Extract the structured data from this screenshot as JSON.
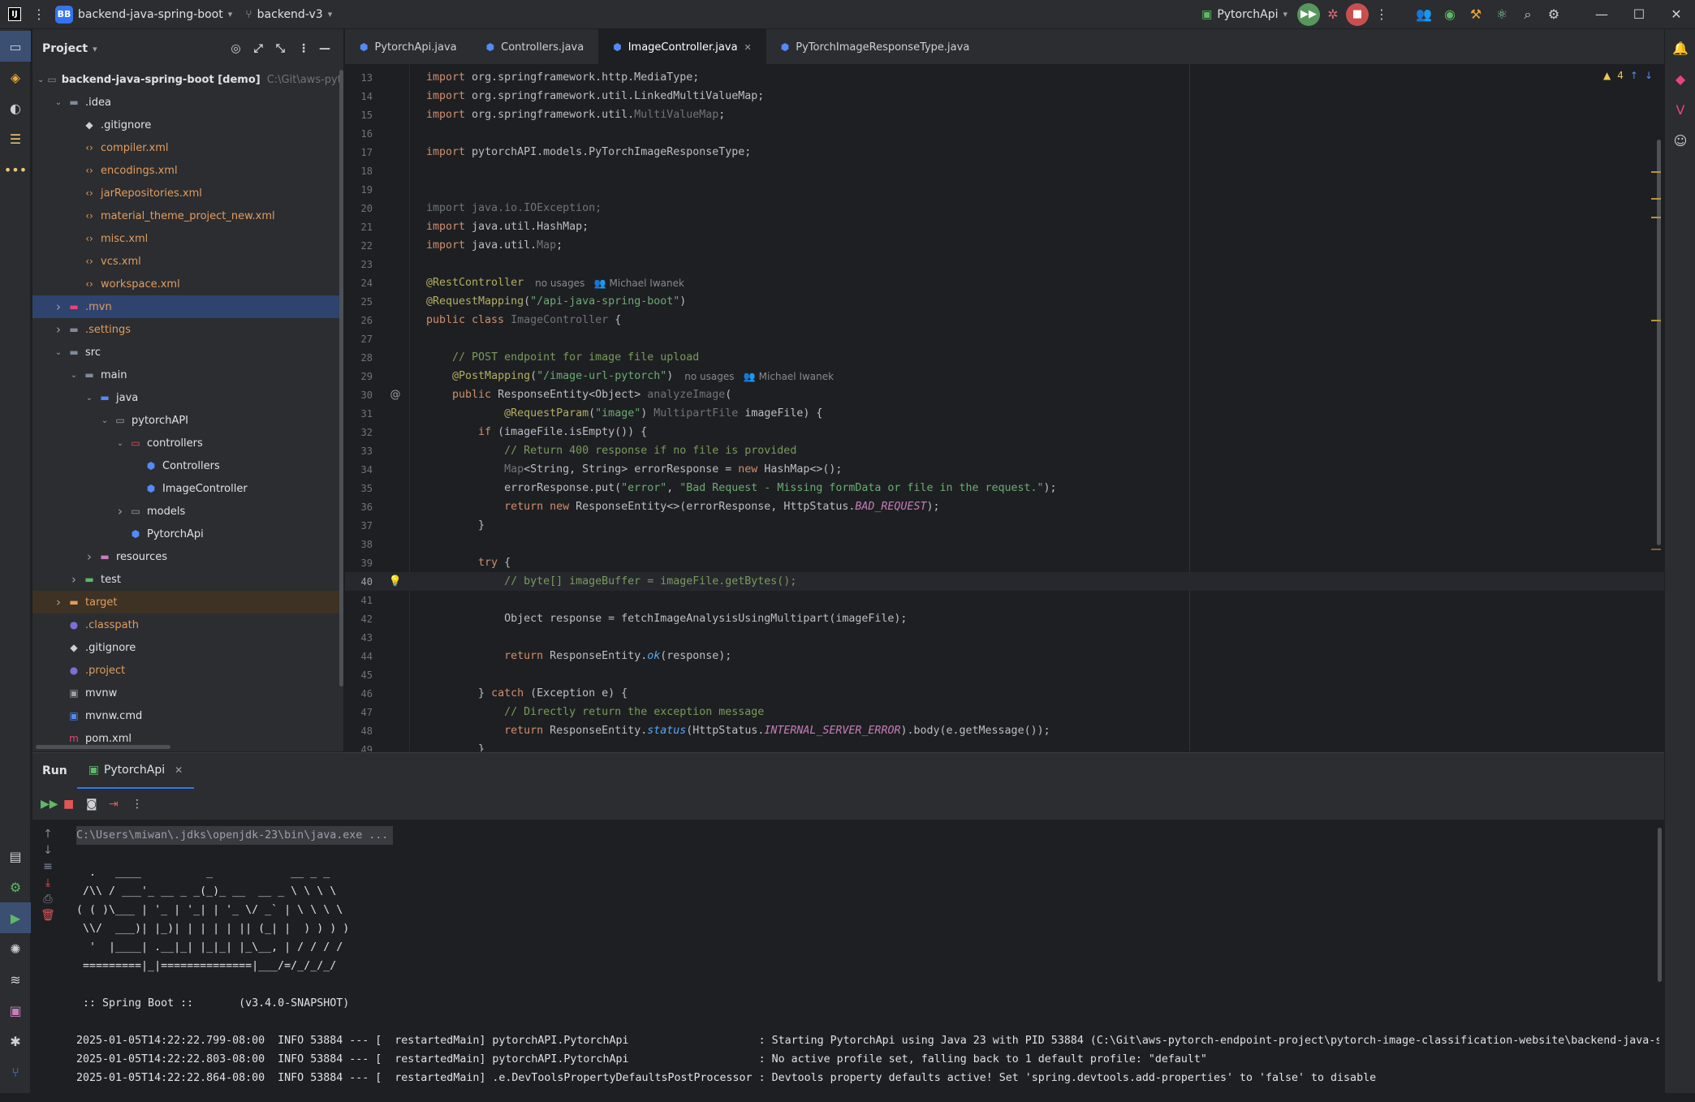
{
  "titlebar": {
    "app_icon": "IJ",
    "project_badge": "BB",
    "project_name": "backend-java-spring-boot",
    "branch": "backend-v3",
    "run_config": "PytorchApi",
    "icons": [
      "menu-icon",
      "run-icon",
      "debug-icon",
      "stop-icon",
      "more-icon",
      "people-icon",
      "status-icon",
      "build-icon",
      "ai-icon",
      "search-icon",
      "settings-icon",
      "minimize-icon",
      "maximize-icon",
      "close-icon"
    ]
  },
  "project_panel": {
    "title": "Project",
    "tree": [
      {
        "indent": 0,
        "arrow": "v",
        "icon": "module",
        "label": "backend-java-spring-boot [demo]",
        "path": "C:\\Git\\aws-pytorch-end",
        "color": "#dfe1e5"
      },
      {
        "indent": 1,
        "arrow": "v",
        "icon": "folder",
        "label": ".idea",
        "color": "#dfe1e5"
      },
      {
        "indent": 2,
        "arrow": "",
        "icon": "git",
        "label": ".gitignore",
        "color": "#dfe1e5"
      },
      {
        "indent": 2,
        "arrow": "",
        "icon": "xml",
        "label": "compiler.xml",
        "color": "#e39c5e"
      },
      {
        "indent": 2,
        "arrow": "",
        "icon": "xml",
        "label": "encodings.xml",
        "color": "#e39c5e"
      },
      {
        "indent": 2,
        "arrow": "",
        "icon": "xml",
        "label": "jarRepositories.xml",
        "color": "#e39c5e"
      },
      {
        "indent": 2,
        "arrow": "",
        "icon": "xml",
        "label": "material_theme_project_new.xml",
        "color": "#e39c5e"
      },
      {
        "indent": 2,
        "arrow": "",
        "icon": "xml",
        "label": "misc.xml",
        "color": "#e39c5e"
      },
      {
        "indent": 2,
        "arrow": "",
        "icon": "xml",
        "label": "vcs.xml",
        "color": "#e39c5e"
      },
      {
        "indent": 2,
        "arrow": "",
        "icon": "xml",
        "label": "workspace.xml",
        "color": "#e39c5e"
      },
      {
        "indent": 1,
        "arrow": ">",
        "icon": "folder-red",
        "label": ".mvn",
        "color": "#e39c5e",
        "selected": true
      },
      {
        "indent": 1,
        "arrow": ">",
        "icon": "folder",
        "label": ".settings",
        "color": "#e39c5e"
      },
      {
        "indent": 1,
        "arrow": "v",
        "icon": "folder",
        "label": "src",
        "color": "#dfe1e5"
      },
      {
        "indent": 2,
        "arrow": "v",
        "icon": "folder",
        "label": "main",
        "color": "#dfe1e5"
      },
      {
        "indent": 3,
        "arrow": "v",
        "icon": "folder-src",
        "label": "java",
        "color": "#dfe1e5"
      },
      {
        "indent": 4,
        "arrow": "v",
        "icon": "package",
        "label": "pytorchAPI",
        "color": "#dfe1e5"
      },
      {
        "indent": 5,
        "arrow": "v",
        "icon": "package-red",
        "label": "controllers",
        "color": "#dfe1e5"
      },
      {
        "indent": 6,
        "arrow": "",
        "icon": "class",
        "label": "Controllers",
        "color": "#dfe1e5"
      },
      {
        "indent": 6,
        "arrow": "",
        "icon": "class",
        "label": "ImageController",
        "color": "#dfe1e5"
      },
      {
        "indent": 5,
        "arrow": ">",
        "icon": "package",
        "label": "models",
        "color": "#dfe1e5"
      },
      {
        "indent": 5,
        "arrow": "",
        "icon": "class-run",
        "label": "PytorchApi",
        "color": "#dfe1e5"
      },
      {
        "indent": 3,
        "arrow": ">",
        "icon": "folder-res",
        "label": "resources",
        "color": "#dfe1e5"
      },
      {
        "indent": 2,
        "arrow": ">",
        "icon": "folder-test",
        "label": "test",
        "color": "#dfe1e5"
      },
      {
        "indent": 1,
        "arrow": ">",
        "icon": "folder-excl",
        "label": "target",
        "color": "#e39c5e",
        "excluded": true
      },
      {
        "indent": 1,
        "arrow": "",
        "icon": "eclipse",
        "label": ".classpath",
        "color": "#e39c5e"
      },
      {
        "indent": 1,
        "arrow": "",
        "icon": "git",
        "label": ".gitignore",
        "color": "#dfe1e5"
      },
      {
        "indent": 1,
        "arrow": "",
        "icon": "eclipse",
        "label": ".project",
        "color": "#e39c5e"
      },
      {
        "indent": 1,
        "arrow": "",
        "icon": "shell",
        "label": "mvnw",
        "color": "#dfe1e5"
      },
      {
        "indent": 1,
        "arrow": "",
        "icon": "cmd",
        "label": "mvnw.cmd",
        "color": "#dfe1e5"
      },
      {
        "indent": 1,
        "arrow": "",
        "icon": "maven",
        "label": "pom.xml",
        "color": "#dfe1e5"
      }
    ]
  },
  "tabs": [
    {
      "label": "PytorchApi.java",
      "active": false
    },
    {
      "label": "Controllers.java",
      "active": false
    },
    {
      "label": "ImageController.java",
      "active": true,
      "closable": true
    },
    {
      "label": "PyTorchImageResponseType.java",
      "active": false
    }
  ],
  "editor": {
    "warnings": "4",
    "lines": [
      {
        "n": "13",
        "html": "<span style='color:#cf8e6d'>import</span> org.springframework.http.MediaType;",
        "dim": false
      },
      {
        "n": "14",
        "html": "<span style='color:#cf8e6d'>import</span> org.springframework.util.LinkedMultiValueMap;"
      },
      {
        "n": "15",
        "html": "<span style='color:#cf8e6d'>import</span> org.springframework.util.<span style='color:#6f737a'>MultiValueMap</span>;"
      },
      {
        "n": "16",
        "html": ""
      },
      {
        "n": "17",
        "html": "<span style='color:#cf8e6d'>import</span> pytorchAPI.models.PyTorchImageResponseType;"
      },
      {
        "n": "18",
        "html": ""
      },
      {
        "n": "19",
        "html": ""
      },
      {
        "n": "20",
        "html": "<span style='color:#6f737a'>import java.io.IOException;</span>"
      },
      {
        "n": "21",
        "html": "<span style='color:#cf8e6d'>import</span> java.util.HashMap;"
      },
      {
        "n": "22",
        "html": "<span style='color:#cf8e6d'>import</span> java.util.<span style='color:#6f737a'>Map</span>;"
      },
      {
        "n": "23",
        "html": ""
      },
      {
        "n": "24",
        "html": "<span style='color:#b3ae60'>@RestController</span>",
        "hint": "no usages   👥 Michael Iwanek"
      },
      {
        "n": "25",
        "html": "<span style='color:#b3ae60'>@RequestMapping</span>(<span style='color:#6aab73'>\"/api-java-spring-boot\"</span>)"
      },
      {
        "n": "26",
        "html": "<span style='color:#cf8e6d'>public class</span> <span style='color:#6f737a'>ImageController</span> {"
      },
      {
        "n": "27",
        "html": ""
      },
      {
        "n": "28",
        "html": "    <span style='color:#7a9a5a'>// POST endpoint for image file upload</span>"
      },
      {
        "n": "29",
        "html": "    <span style='color:#b3ae60'>@PostMapping</span>(<span style='color:#6aab73'>\"/image-url-pytorch\"</span>)",
        "hint": "no usages   👥 Michael Iwanek"
      },
      {
        "n": "30",
        "html": "    <span style='color:#cf8e6d'>public</span> ResponseEntity&lt;Object&gt; <span style='color:#6f737a'>analyzeImage</span>(",
        "gutter": "@"
      },
      {
        "n": "31",
        "html": "            <span style='color:#b3ae60'>@RequestParam</span>(<span style='color:#6aab73'>\"image\"</span>) <span style='color:#6f737a'>MultipartFile</span> imageFile) {"
      },
      {
        "n": "32",
        "html": "        <span style='color:#cf8e6d'>if</span> (imageFile.isEmpty()) {"
      },
      {
        "n": "33",
        "html": "            <span style='color:#7a9a5a'>// Return 400 response if no file is provided</span>"
      },
      {
        "n": "34",
        "html": "            <span style='color:#6f737a'>Map</span>&lt;String, String&gt; errorResponse = <span style='color:#cf8e6d'>new</span> HashMap&lt;&gt;();"
      },
      {
        "n": "35",
        "html": "            errorResponse.put(<span style='color:#6aab73'>\"error\"</span>, <span style='color:#6aab73'>\"Bad Request - Missing formData or file in the request.\"</span>);"
      },
      {
        "n": "36",
        "html": "            <span style='color:#cf8e6d'>return new</span> ResponseEntity&lt;&gt;(errorResponse, HttpStatus.<span style='color:#c77dbb;font-style:italic'>BAD_REQUEST</span>);"
      },
      {
        "n": "37",
        "html": "        }"
      },
      {
        "n": "38",
        "html": ""
      },
      {
        "n": "39",
        "html": "        <span style='color:#cf8e6d'>try</span> {"
      },
      {
        "n": "40",
        "html": "            <span style='color:#7a9a5a'>// byte[] imageBuffer = imageFile.getBytes();</span>",
        "gutter": "💡",
        "current": true
      },
      {
        "n": "41",
        "html": ""
      },
      {
        "n": "42",
        "html": "            Object response = fetchImageAnalysisUsingMultipart(imageFile);"
      },
      {
        "n": "43",
        "html": ""
      },
      {
        "n": "44",
        "html": "            <span style='color:#cf8e6d'>return</span> ResponseEntity.<span style='font-style:italic;color:#56a8f5'>ok</span>(response);"
      },
      {
        "n": "45",
        "html": ""
      },
      {
        "n": "46",
        "html": "        } <span style='color:#cf8e6d'>catch</span> (Exception e) {"
      },
      {
        "n": "47",
        "html": "            <span style='color:#7a9a5a'>// Directly return the exception message</span>"
      },
      {
        "n": "48",
        "html": "            <span style='color:#cf8e6d'>return</span> ResponseEntity.<span style='font-style:italic;color:#56a8f5'>status</span>(HttpStatus.<span style='color:#c77dbb;font-style:italic'>INTERNAL_SERVER_ERROR</span>).body(e.getMessage());"
      },
      {
        "n": "49",
        "html": "        }"
      }
    ]
  },
  "run_panel": {
    "title": "Run",
    "tab": "PytorchApi",
    "console": [
      "C:\\Users\\miwan\\.jdks\\openjdk-23\\bin\\java.exe ...",
      "",
      "  .   ____          _            __ _ _",
      " /\\\\ / ___'_ __ _ _(_)_ __  __ _ \\ \\ \\ \\",
      "( ( )\\___ | '_ | '_| | '_ \\/ _` | \\ \\ \\ \\",
      " \\\\/  ___)| |_)| | | | | || (_| |  ) ) ) )",
      "  '  |____| .__|_| |_|_| |_\\__, | / / / /",
      " =========|_|==============|___/=/_/_/_/",
      "",
      " :: Spring Boot ::       (v3.4.0-SNAPSHOT)",
      "",
      "2025-01-05T14:22:22.799-08:00  INFO 53884 --- [  restartedMain] pytorchAPI.PytorchApi                    : Starting PytorchApi using Java 23 with PID 53884 (C:\\Git\\aws-pytorch-endpoint-project\\pytorch-image-classification-website\\backend-java-sp",
      "2025-01-05T14:22:22.803-08:00  INFO 53884 --- [  restartedMain] pytorchAPI.PytorchApi                    : No active profile set, falling back to 1 default profile: \"default\"",
      "2025-01-05T14:22:22.864-08:00  INFO 53884 --- [  restartedMain] .e.DevToolsPropertyDefaultsPostProcessor : Devtools property defaults active! Set 'spring.devtools.add-properties' to 'false' to disable"
    ]
  }
}
